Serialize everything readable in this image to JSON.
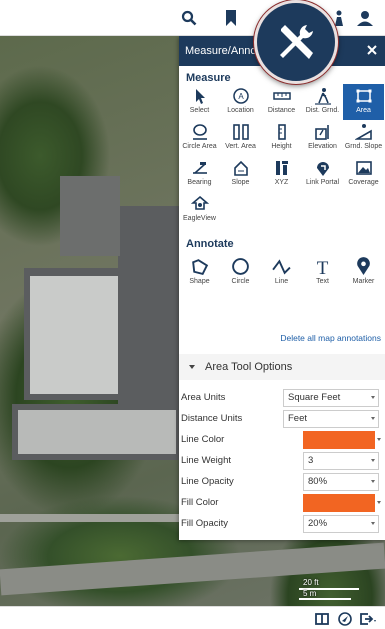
{
  "panel": {
    "title": "Measure/Annot",
    "measure_title": "Measure",
    "annotate_title": "Annotate",
    "measure_tools": [
      {
        "label": "Select",
        "icon": "cursor-icon"
      },
      {
        "label": "Location",
        "icon": "location-icon"
      },
      {
        "label": "Distance",
        "icon": "ruler-icon"
      },
      {
        "label": "Dist. Grnd.",
        "icon": "walker-icon"
      },
      {
        "label": "Area",
        "icon": "area-icon"
      },
      {
        "label": "Circle Area",
        "icon": "circle-area-icon"
      },
      {
        "label": "Vert. Area",
        "icon": "vertical-area-icon"
      },
      {
        "label": "Height",
        "icon": "height-icon"
      },
      {
        "label": "Elevation",
        "icon": "elevation-icon"
      },
      {
        "label": "Grnd. Slope",
        "icon": "ground-slope-icon"
      },
      {
        "label": "Bearing",
        "icon": "bearing-icon"
      },
      {
        "label": "Slope",
        "icon": "slope-icon"
      },
      {
        "label": "XYZ",
        "icon": "xyz-icon"
      },
      {
        "label": "Link Portal",
        "icon": "link-portal-icon"
      },
      {
        "label": "Coverage",
        "icon": "coverage-icon"
      },
      {
        "label": "EagleView",
        "icon": "eagleview-icon"
      }
    ],
    "annotate_tools": [
      {
        "label": "Shape",
        "icon": "shape-icon"
      },
      {
        "label": "Circle",
        "icon": "circle-icon"
      },
      {
        "label": "Line",
        "icon": "line-icon"
      },
      {
        "label": "Text",
        "icon": "text-icon",
        "glyph": "T"
      },
      {
        "label": "Marker",
        "icon": "marker-icon"
      }
    ],
    "delete_link": "Delete all map annotations",
    "options_title": "Area Tool Options",
    "options": {
      "area_units": {
        "label": "Area Units",
        "value": "Square Feet"
      },
      "distance_units": {
        "label": "Distance Units",
        "value": "Feet"
      },
      "line_color": {
        "label": "Line Color",
        "value": "#f26522"
      },
      "line_weight": {
        "label": "Line Weight",
        "value": "3"
      },
      "line_opacity": {
        "label": "Line Opacity",
        "value": "80%"
      },
      "fill_color": {
        "label": "Fill Color",
        "value": "#f26522"
      },
      "fill_opacity": {
        "label": "Fill Opacity",
        "value": "20%"
      }
    }
  },
  "map": {
    "scale_feet": "20 ft",
    "scale_meters": "5 m"
  },
  "colors": {
    "header": "#1d3a5c",
    "active_tool": "#1f5fa8",
    "accent": "#f26522"
  }
}
